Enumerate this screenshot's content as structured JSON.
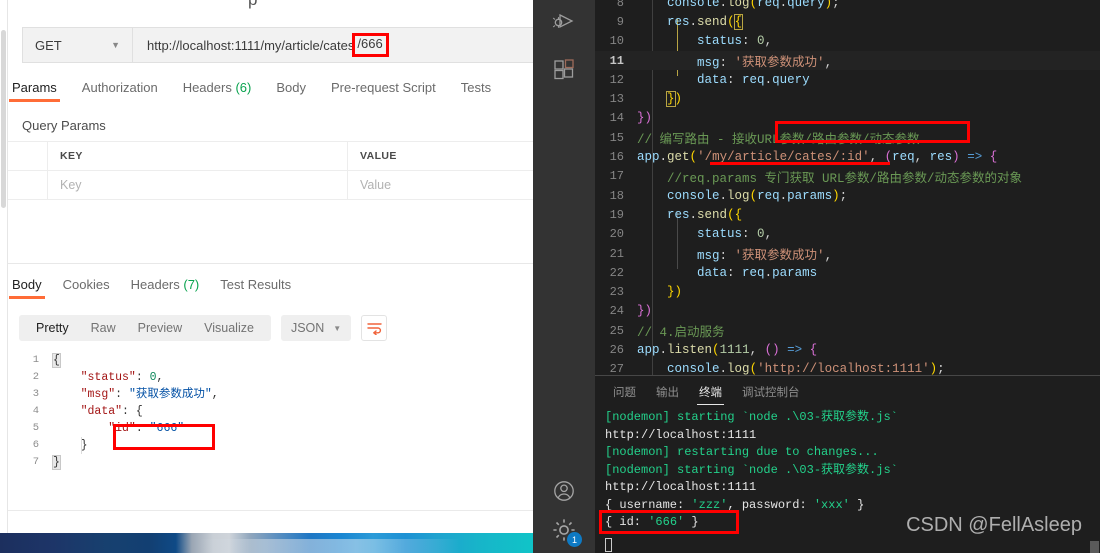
{
  "postman": {
    "method": "GET",
    "url_base": "http://localhost:1111/my/article/cates",
    "url_highlight": "/666",
    "request_tabs": [
      {
        "label": "Params",
        "count": "",
        "active": true
      },
      {
        "label": "Authorization",
        "count": "",
        "active": false
      },
      {
        "label": "Headers",
        "count": "(6)",
        "active": false
      },
      {
        "label": "Body",
        "count": "",
        "active": false
      },
      {
        "label": "Pre-request Script",
        "count": "",
        "active": false
      },
      {
        "label": "Tests",
        "count": "",
        "active": false
      }
    ],
    "query_params_label": "Query Params",
    "table": {
      "headers": [
        "KEY",
        "VALUE"
      ],
      "placeholders": [
        "Key",
        "Value"
      ]
    },
    "response_tabs": [
      {
        "label": "Body",
        "count": "",
        "active": true
      },
      {
        "label": "Cookies",
        "count": "",
        "active": false
      },
      {
        "label": "Headers",
        "count": "(7)",
        "active": false
      },
      {
        "label": "Test Results",
        "count": "",
        "active": false
      }
    ],
    "format_buttons": [
      "Pretty",
      "Raw",
      "Preview",
      "Visualize"
    ],
    "format_active": "Pretty",
    "content_type": "JSON",
    "json_body_lines": [
      {
        "n": "1",
        "text": "{"
      },
      {
        "n": "2",
        "text": "    \"status\": 0,"
      },
      {
        "n": "3",
        "text": "    \"msg\": \"获取参数成功\","
      },
      {
        "n": "4",
        "text": "    \"data\": {"
      },
      {
        "n": "5",
        "text": "        \"id\": \"666\""
      },
      {
        "n": "6",
        "text": "    }"
      },
      {
        "n": "7",
        "text": "}"
      }
    ]
  },
  "activity_bar": {
    "items": [
      {
        "icon": "run-and-debug-icon",
        "badge": ""
      },
      {
        "icon": "extensions-icon",
        "badge": ""
      },
      {
        "icon": "account-icon",
        "badge": ""
      },
      {
        "icon": "settings-gear-icon",
        "badge": "1"
      }
    ]
  },
  "editor": {
    "lines": [
      {
        "n": "8",
        "text": "    console.log(req.query);",
        "current": false
      },
      {
        "n": "9",
        "text": "    res.send({",
        "current": false
      },
      {
        "n": "10",
        "text": "        status: 0,",
        "current": false
      },
      {
        "n": "11",
        "text": "        msg: '获取参数成功',",
        "current": true
      },
      {
        "n": "12",
        "text": "        data: req.query",
        "current": false
      },
      {
        "n": "13",
        "text": "    })",
        "current": false
      },
      {
        "n": "14",
        "text": "})",
        "current": false
      },
      {
        "n": "15",
        "text": "// 编写路由 - 接收URL参数/路由参数/动态参数",
        "current": false
      },
      {
        "n": "16",
        "text": "app.get('/my/article/cates/:id', (req, res) => {",
        "current": false
      },
      {
        "n": "17",
        "text": "    //req.params 专门获取 URL参数/路由参数/动态参数的对象",
        "current": false
      },
      {
        "n": "18",
        "text": "    console.log(req.params);",
        "current": false
      },
      {
        "n": "19",
        "text": "    res.send({",
        "current": false
      },
      {
        "n": "20",
        "text": "        status: 0,",
        "current": false
      },
      {
        "n": "21",
        "text": "        msg: '获取参数成功',",
        "current": false
      },
      {
        "n": "22",
        "text": "        data: req.params",
        "current": false
      },
      {
        "n": "23",
        "text": "    })",
        "current": false
      },
      {
        "n": "24",
        "text": "})",
        "current": false
      },
      {
        "n": "25",
        "text": "// 4.启动服务",
        "current": false
      },
      {
        "n": "26",
        "text": "app.listen(1111, () => {",
        "current": false
      },
      {
        "n": "27",
        "text": "    console.log('http://localhost:1111');",
        "current": false
      }
    ],
    "highlight_comment": "URL参数/路由参数/动态参数"
  },
  "terminal": {
    "tabs": [
      {
        "label": "问题",
        "active": false
      },
      {
        "label": "输出",
        "active": false
      },
      {
        "label": "终端",
        "active": true
      },
      {
        "label": "调试控制台",
        "active": false
      }
    ],
    "lines": [
      {
        "text": "[nodemon] starting `node .\\03-获取参数.js`",
        "color": "green"
      },
      {
        "text": "http://localhost:1111",
        "color": "white"
      },
      {
        "text": "[nodemon] restarting due to changes...",
        "color": "green"
      },
      {
        "text": "[nodemon] starting `node .\\03-获取参数.js`",
        "color": "green"
      },
      {
        "text": "http://localhost:1111",
        "color": "white"
      },
      {
        "text": "{ username: 'zzz', password: 'xxx' }",
        "color": "white"
      },
      {
        "text": "{ id: '666' }",
        "color": "white"
      }
    ],
    "watermark": "CSDN @FellAsleep"
  },
  "colors": {
    "accent_orange": "#ff6c37",
    "highlight_red": "#ff0000",
    "badge_blue": "#0e7ac4",
    "terminal_green": "#23d18b"
  }
}
